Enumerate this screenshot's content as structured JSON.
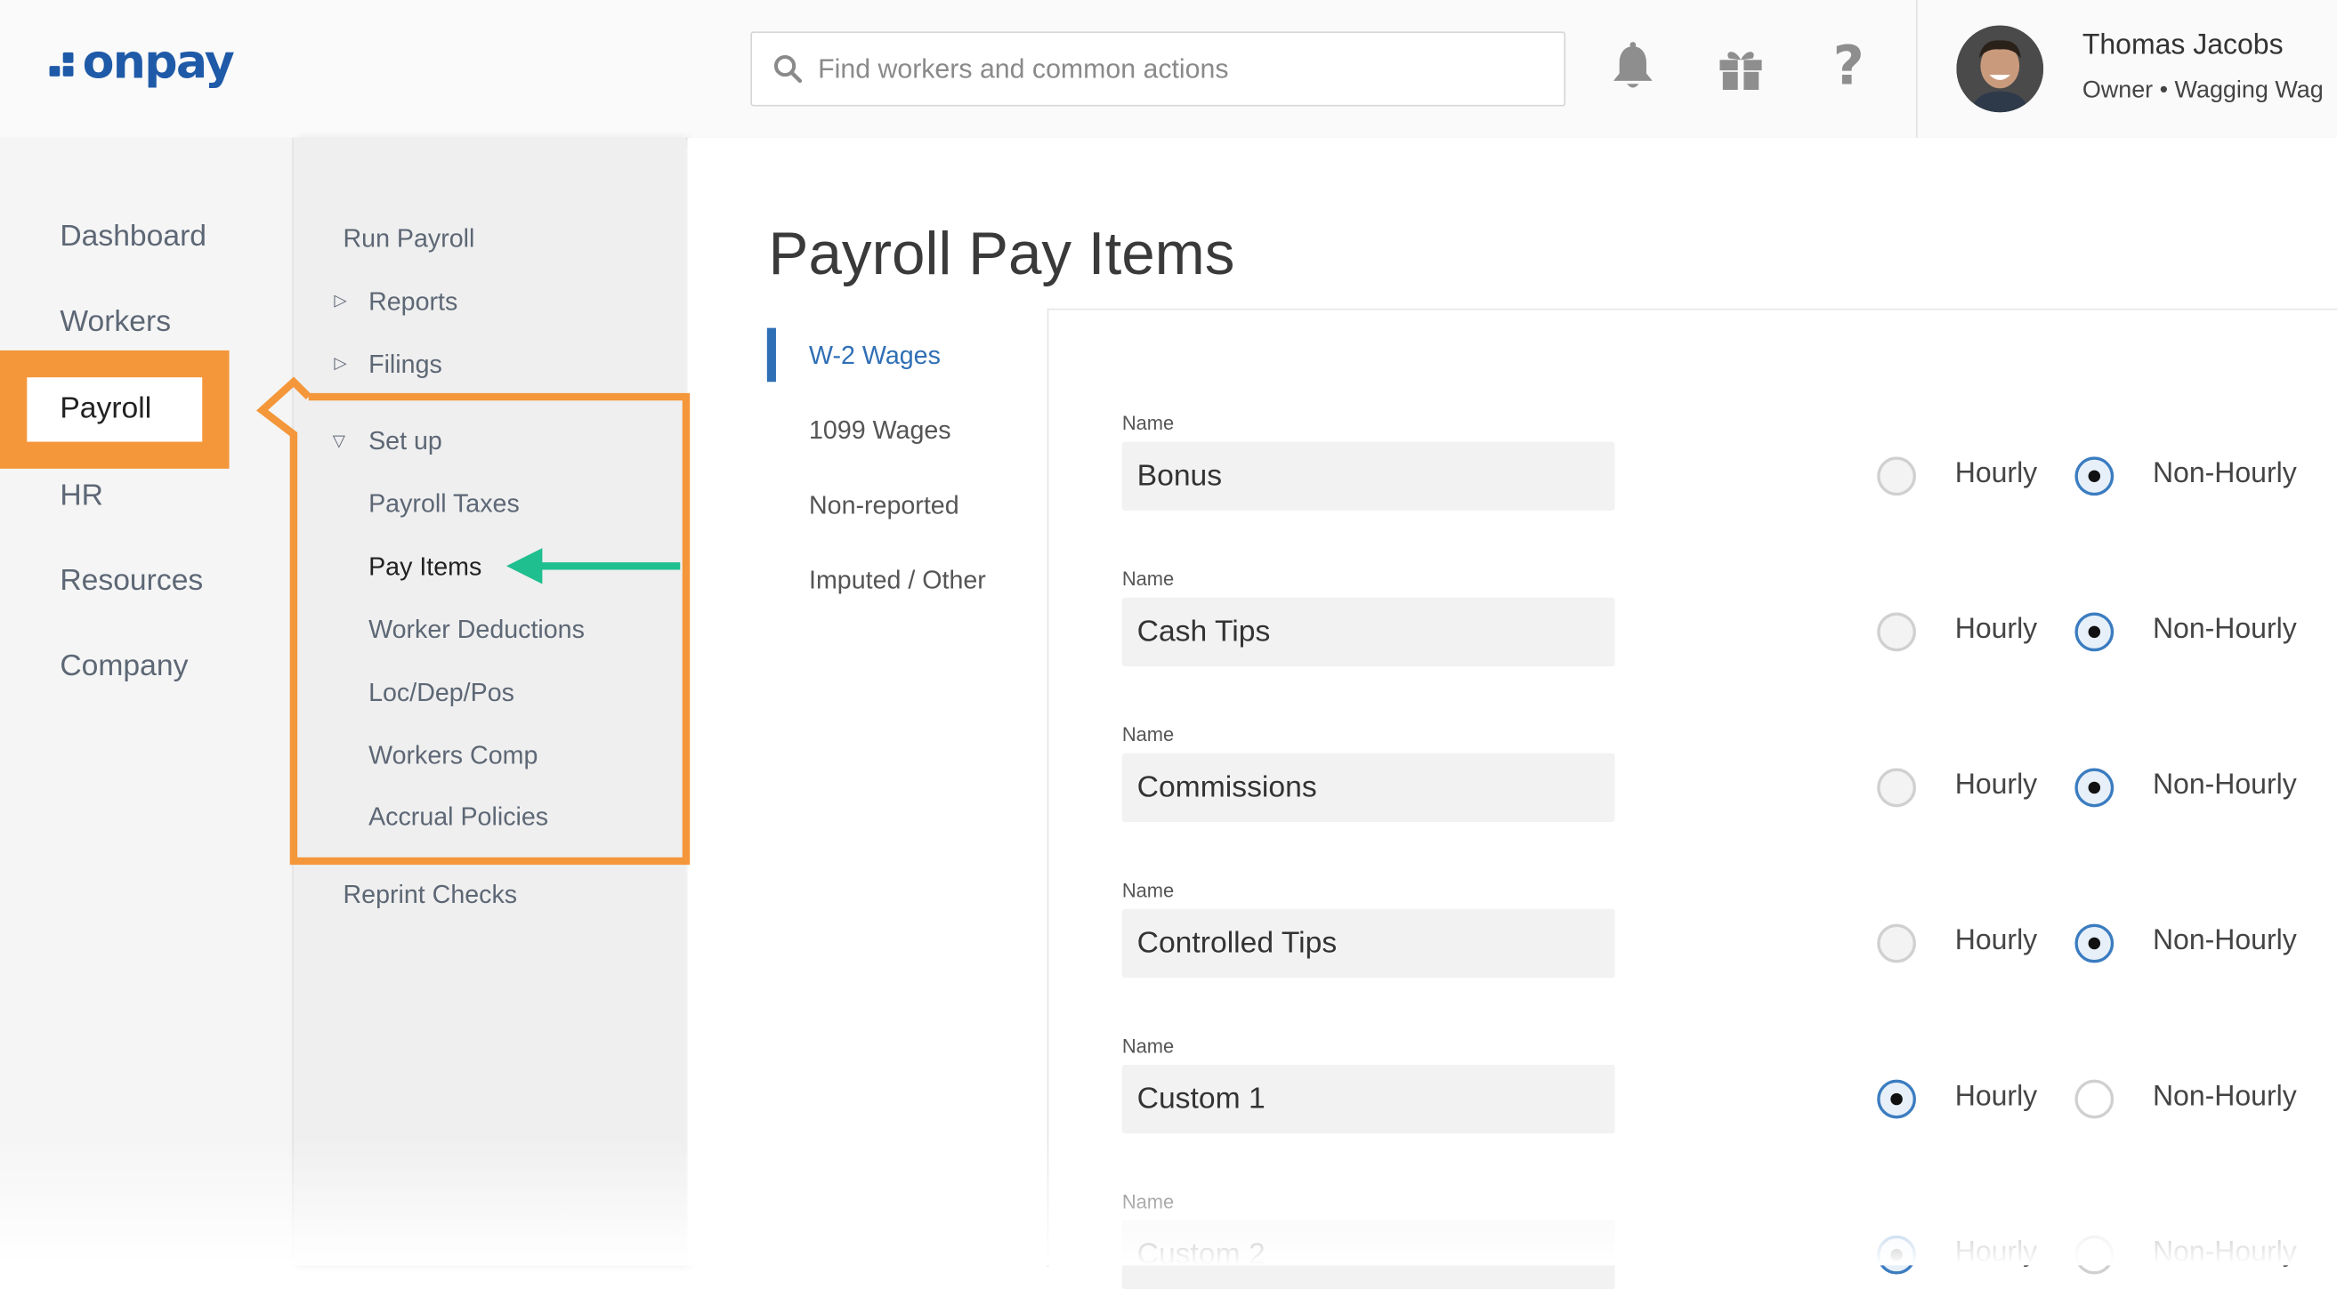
{
  "header": {
    "logo_text": "onpay",
    "search_placeholder": "Find workers and common actions",
    "user_name": "Thomas Jacobs",
    "user_role": "Owner • Wagging Wag"
  },
  "primary_nav": {
    "items": [
      {
        "label": "Dashboard"
      },
      {
        "label": "Workers"
      },
      {
        "label": "Payroll",
        "active": true
      },
      {
        "label": "HR"
      },
      {
        "label": "Resources"
      },
      {
        "label": "Company"
      }
    ]
  },
  "secondary_nav": {
    "run_payroll": "Run Payroll",
    "reports": "Reports",
    "filings": "Filings",
    "setup": "Set up",
    "setup_items": [
      {
        "label": "Payroll Taxes"
      },
      {
        "label": "Pay Items",
        "active": true
      },
      {
        "label": "Worker Deductions"
      },
      {
        "label": "Loc/Dep/Pos"
      },
      {
        "label": "Workers Comp"
      },
      {
        "label": "Accrual Policies"
      }
    ],
    "reprint_checks": "Reprint Checks"
  },
  "main": {
    "title": "Payroll Pay Items",
    "tabs": [
      {
        "label": "W-2 Wages",
        "active": true
      },
      {
        "label": "1099 Wages"
      },
      {
        "label": "Non-reported"
      },
      {
        "label": "Imputed / Other"
      }
    ],
    "field_label": "Name",
    "option_hourly": "Hourly",
    "option_non_hourly": "Non-Hourly",
    "pay_items": [
      {
        "name": "Bonus",
        "selected": "Non-Hourly"
      },
      {
        "name": "Cash Tips",
        "selected": "Non-Hourly"
      },
      {
        "name": "Commissions",
        "selected": "Non-Hourly"
      },
      {
        "name": "Controlled Tips",
        "selected": "Non-Hourly"
      },
      {
        "name": "Custom 1",
        "selected": "Hourly"
      },
      {
        "name": "Custom 2",
        "selected": "Hourly"
      }
    ]
  },
  "colors": {
    "brand_blue": "#1f5aa8",
    "annotation_orange": "#f4963a",
    "annotation_green": "#1fbf8f",
    "radio_accent": "#3b7cc0"
  }
}
